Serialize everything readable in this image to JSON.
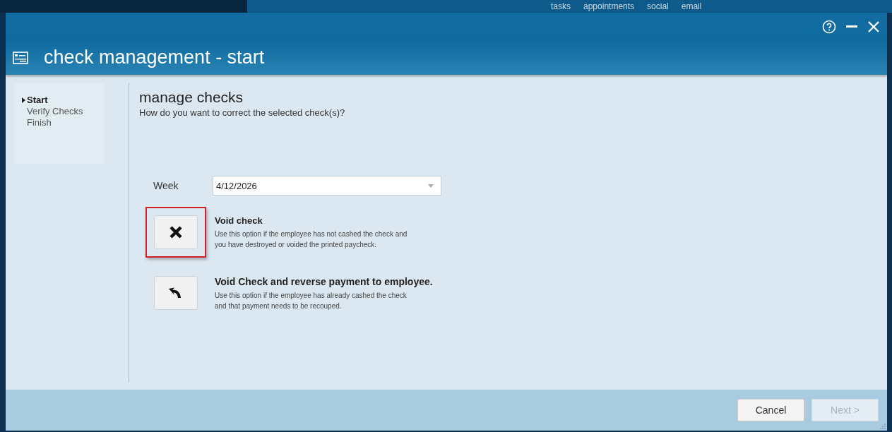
{
  "background_nav": [
    "tasks",
    "appointments",
    "social",
    "email"
  ],
  "window": {
    "title": "check management - start"
  },
  "steps": [
    {
      "label": "Start",
      "selected": true
    },
    {
      "label": "Verify Checks",
      "selected": false
    },
    {
      "label": "Finish",
      "selected": false
    }
  ],
  "heading": "manage checks",
  "question": "How do you want to correct the selected check(s)?",
  "week": {
    "label": "Week",
    "value": "4/12/2026"
  },
  "options": [
    {
      "kind": "void",
      "title": "Void check",
      "description": "Use this option if the employee has not cashed the check and you have destroyed or voided the printed paycheck.",
      "highlighted": true
    },
    {
      "kind": "reverse",
      "title": "Void Check and reverse payment to employee.",
      "description": "Use this option if the employee has already cashed the check and that payment needs to be recouped.",
      "highlighted": false
    }
  ],
  "buttons": [
    {
      "label": "Cancel",
      "disabled": false
    },
    {
      "label": "Next >",
      "disabled": true
    }
  ]
}
